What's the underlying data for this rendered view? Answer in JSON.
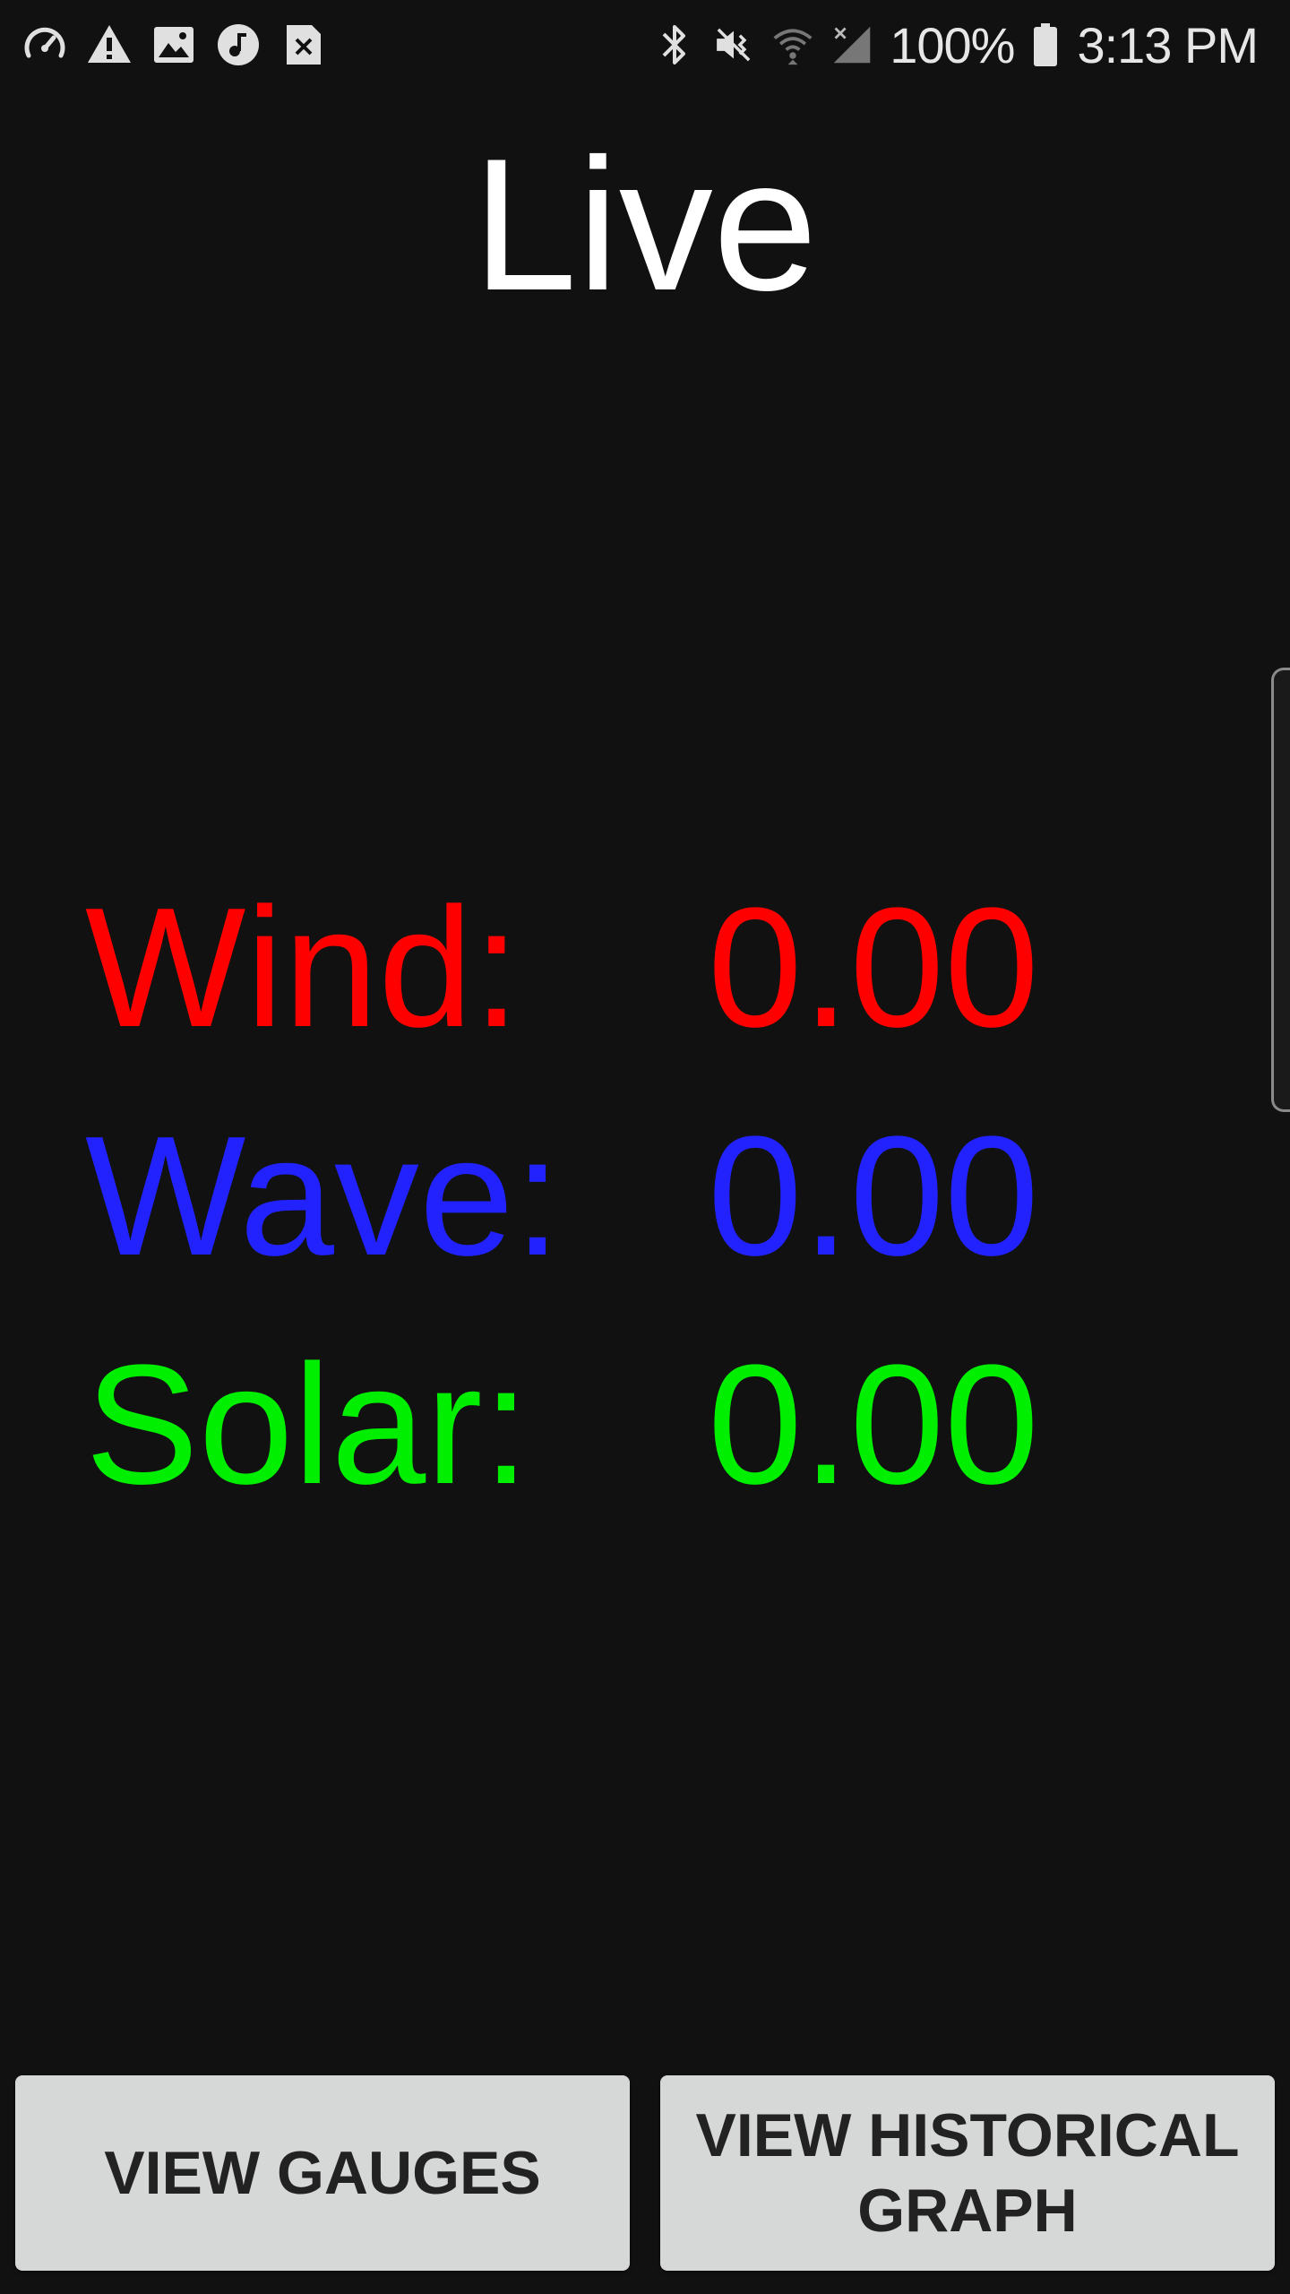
{
  "status_bar": {
    "battery_percent": "100%",
    "time": "3:13 PM",
    "left_icons": [
      "speedometer-icon",
      "warning-icon",
      "image-icon",
      "music-icon",
      "sim-error-icon"
    ],
    "right_icons": [
      "bluetooth-icon",
      "vibrate-icon",
      "wifi-icon",
      "signal-icon",
      "battery-icon"
    ]
  },
  "title": "Live",
  "readings": [
    {
      "label": "Wind:",
      "value": "0.00",
      "color": "#ff0000"
    },
    {
      "label": "Wave:",
      "value": "0.00",
      "color": "#2222ff"
    },
    {
      "label": "Solar:",
      "value": "0.00",
      "color": "#00ee00"
    }
  ],
  "buttons": {
    "gauges_label": "VIEW GAUGES",
    "graph_label_line1": "VIEW HISTORICAL",
    "graph_label_line2": "GRAPH"
  }
}
